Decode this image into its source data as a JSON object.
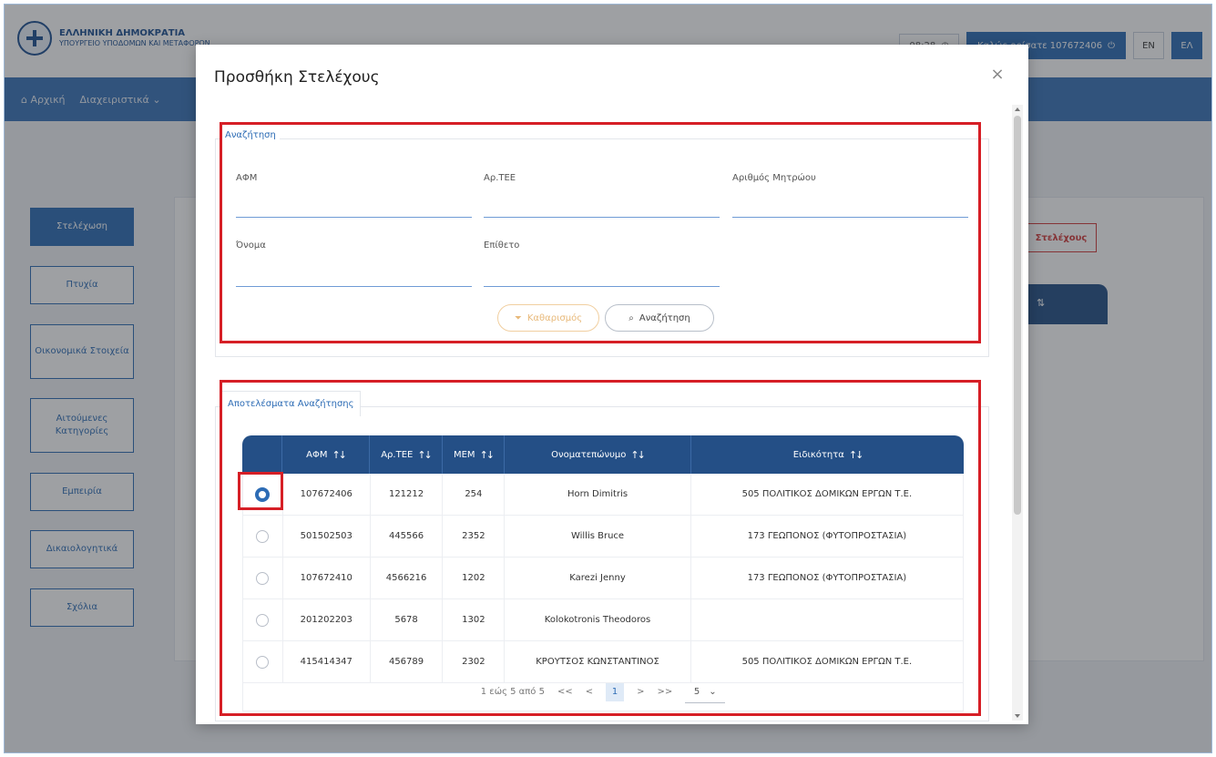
{
  "header": {
    "logo_line1": "ΕΛΛΗΝΙΚΗ ΔΗΜΟΚΡΑΤΙΑ",
    "logo_line2": "ΥΠΟΥΡΓΕΙΟ ΥΠΟΔΟΜΩΝ ΚΑΙ ΜΕΤΑΦΟΡΩΝ",
    "clock": "08:28",
    "welcome": "Καλώς ορίσατε 107672406",
    "lang_en": "EN",
    "lang_el": "ΕΛ"
  },
  "nav": {
    "home": "Αρχική",
    "admin": "Διαχειριστικά"
  },
  "sidebar": {
    "items": [
      {
        "label": "Στελέχωση"
      },
      {
        "label": "Πτυχία"
      },
      {
        "label": "Οικονομικά Στοιχεία"
      },
      {
        "label": "Αιτούμενες Κατηγορίες"
      },
      {
        "label": "Εμπειρία"
      },
      {
        "label": "Δικαιολογητικά"
      },
      {
        "label": "Σχόλια"
      }
    ]
  },
  "background": {
    "add_button": "Στελέχους"
  },
  "modal": {
    "title": "Προσθήκη Στελέχους",
    "close": "×",
    "search": {
      "legend": "Αναζήτηση",
      "afm_label": "ΑΦΜ",
      "tee_label": "Αρ.ΤΕΕ",
      "registry_label": "Αριθμός Μητρώου",
      "name_label": "Όνομα",
      "surname_label": "Επίθετο",
      "clear_button": "Καθαρισμός",
      "search_button": "Αναζήτηση"
    },
    "results": {
      "legend": "Αποτελέσματα Αναζήτησης",
      "columns": [
        "ΑΦΜ",
        "Αρ.ΤΕΕ",
        "ΜΕΜ",
        "Ονοματεπώνυμο",
        "Ειδικότητα"
      ],
      "rows": [
        {
          "afm": "107672406",
          "tee": "121212",
          "mem": "254",
          "name": "Horn Dimitris",
          "specialty": "505 ΠΟΛΙΤΙΚΟΣ ΔΟΜΙΚΩΝ ΕΡΓΩΝ Τ.Ε.",
          "selected": true
        },
        {
          "afm": "501502503",
          "tee": "445566",
          "mem": "2352",
          "name": "Willis Bruce",
          "specialty": "173 ΓΕΩΠΟΝΟΣ (ΦΥΤΟΠΡΟΣΤΑΣΙΑ)",
          "selected": false
        },
        {
          "afm": "107672410",
          "tee": "4566216",
          "mem": "1202",
          "name": "Karezi Jenny",
          "specialty": "173 ΓΕΩΠΟΝΟΣ (ΦΥΤΟΠΡΟΣΤΑΣΙΑ)",
          "selected": false
        },
        {
          "afm": "201202203",
          "tee": "5678",
          "mem": "1302",
          "name": "Kolokotronis Theodoros",
          "specialty": "",
          "selected": false
        },
        {
          "afm": "415414347",
          "tee": "456789",
          "mem": "2302",
          "name": "ΚΡΟΥΤΣΟΣ ΚΩΝΣΤΑΝΤΙΝΟΣ",
          "specialty": "505 ΠΟΛΙΤΙΚΟΣ ΔΟΜΙΚΩΝ ΕΡΓΩΝ Τ.Ε.",
          "selected": false
        }
      ],
      "pager": {
        "summary": "1 εώς 5 από 5",
        "first": "<<",
        "prev": "<",
        "current": "1",
        "next": ">",
        "last": ">>",
        "page_size": "5"
      }
    }
  },
  "colors": {
    "primary": "#2d6cb5",
    "table_header": "#244f86",
    "highlight_red": "#d61f26"
  }
}
